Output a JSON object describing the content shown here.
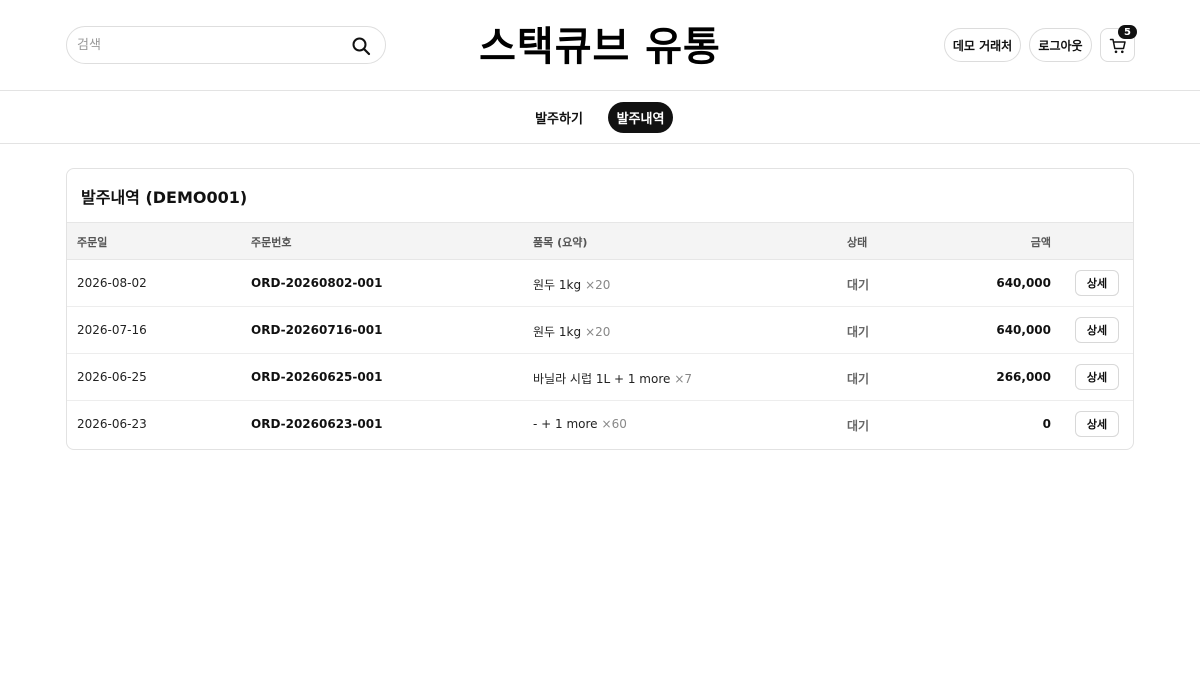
{
  "header": {
    "search_placeholder": "검색",
    "brand": "스택큐브 유통",
    "demo_label": "데모 거래처",
    "logout_label": "로그아웃",
    "cart_count": "5"
  },
  "nav": {
    "tabs": [
      {
        "label": "발주하기",
        "active": false
      },
      {
        "label": "발주내역",
        "active": true
      }
    ]
  },
  "orders": {
    "title": "발주내역 (DEMO001)",
    "columns": {
      "date": "주문일",
      "order_no": "주문번호",
      "items": "품목 (요약)",
      "status": "상태",
      "amount": "금액"
    },
    "rows": [
      {
        "date": "2026-08-02",
        "order_no": "ORD-20260802-001",
        "items": "원두 1kg",
        "qty": "×20",
        "status": "대기",
        "amount": "640,000",
        "action": "상세"
      },
      {
        "date": "2026-07-16",
        "order_no": "ORD-20260716-001",
        "items": "원두 1kg",
        "qty": "×20",
        "status": "대기",
        "amount": "640,000",
        "action": "상세"
      },
      {
        "date": "2026-06-25",
        "order_no": "ORD-20260625-001",
        "items": "바닐라 시럽 1L + 1 more",
        "qty": "×7",
        "status": "대기",
        "amount": "266,000",
        "action": "상세"
      },
      {
        "date": "2026-06-23",
        "order_no": "ORD-20260623-001",
        "items": "- + 1 more",
        "qty": "×60",
        "status": "대기",
        "amount": "0",
        "action": "상세"
      }
    ]
  },
  "colors": {
    "accent": "#111111",
    "border": "#e2e2e2",
    "header_bg": "#f4f4f4",
    "muted": "#888888"
  },
  "icons": [
    "search-icon",
    "cart-icon"
  ]
}
